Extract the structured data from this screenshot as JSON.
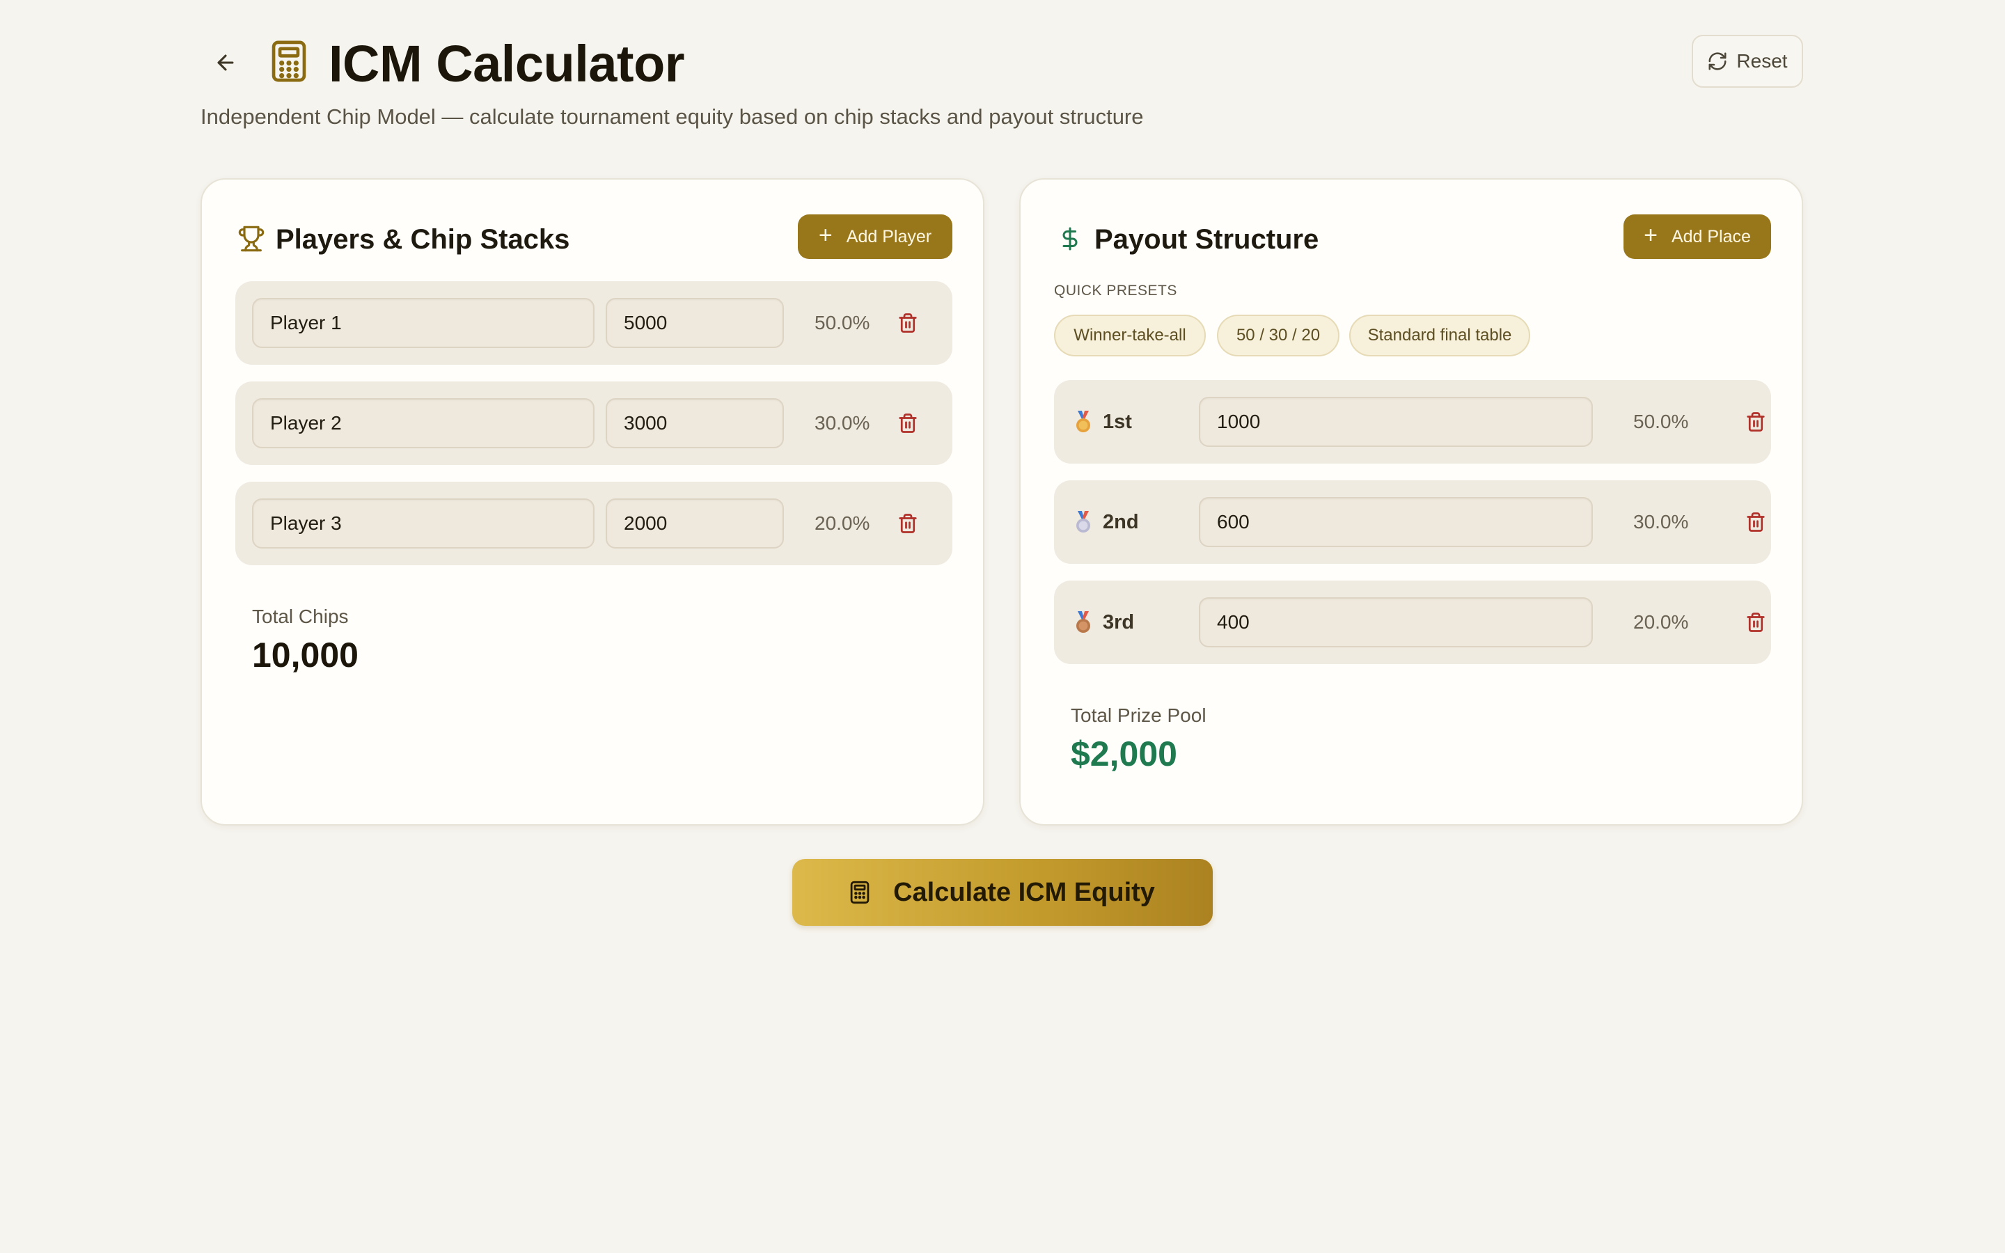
{
  "header": {
    "title": "ICM Calculator",
    "subtitle": "Independent Chip Model — calculate tournament equity based on chip stacks and payout structure",
    "reset_label": "Reset",
    "back_icon": "arrow-left-icon",
    "title_icon": "calculator-icon"
  },
  "players_card": {
    "title": "Players & Chip Stacks",
    "icon": "trophy-icon",
    "add_label": "Add Player",
    "players": [
      {
        "name": "Player 1",
        "chips": "5000",
        "percent": "50.0%"
      },
      {
        "name": "Player 2",
        "chips": "3000",
        "percent": "30.0%"
      },
      {
        "name": "Player 3",
        "chips": "2000",
        "percent": "20.0%"
      }
    ],
    "total_label": "Total Chips",
    "total_value": "10,000"
  },
  "payout_card": {
    "title": "Payout Structure",
    "icon": "dollar-icon",
    "add_label": "Add Place",
    "presets_label": "QUICK PRESETS",
    "presets": [
      "Winner-take-all",
      "50 / 30 / 20",
      "Standard final table"
    ],
    "places": [
      {
        "place": "1st",
        "amount": "1000",
        "percent": "50.0%",
        "medal": "gold-medal-icon"
      },
      {
        "place": "2nd",
        "amount": "600",
        "percent": "30.0%",
        "medal": "silver-medal-icon"
      },
      {
        "place": "3rd",
        "amount": "400",
        "percent": "20.0%",
        "medal": "bronze-medal-icon"
      }
    ],
    "total_label": "Total Prize Pool",
    "total_value": "$2,000"
  },
  "calculate_label": "Calculate ICM Equity",
  "colors": {
    "background": "#f6f4ee",
    "accent": "#98771a",
    "danger": "#b0302a",
    "prize_green": "#1f7a4f"
  }
}
